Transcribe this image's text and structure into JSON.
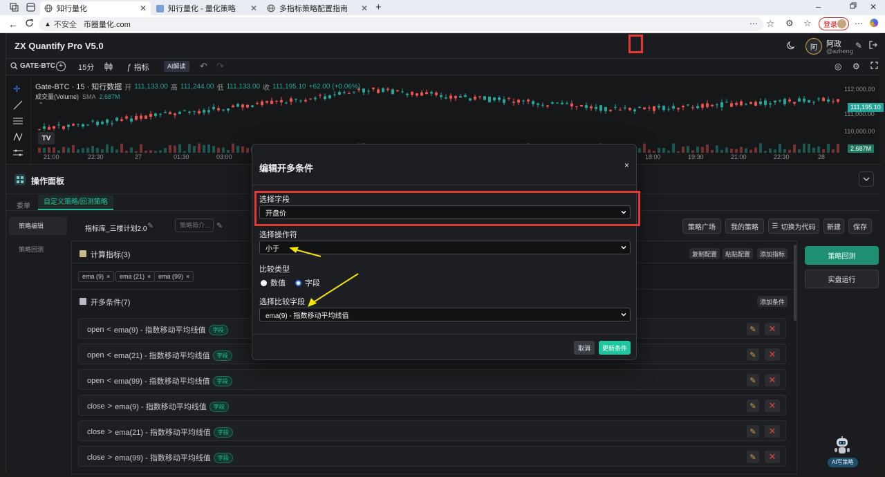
{
  "browser": {
    "tabs": [
      {
        "title": "知行量化",
        "active": true
      },
      {
        "title": "知行量化 - 量化策略",
        "active": false
      },
      {
        "title": "多指标策略配置指南",
        "active": false
      }
    ],
    "insecure_label": "不安全",
    "url": "币圈量化.com",
    "login_label": "登录"
  },
  "app": {
    "title": "ZX Quantify Pro V5.0",
    "user": {
      "avatar_text": "阿",
      "name": "阿政",
      "handle": "@azheng"
    }
  },
  "toolbar": {
    "symbol": "GATE-BTC",
    "interval": "15分",
    "indicator_label": "指标",
    "ai_label": "AI解读"
  },
  "chart": {
    "legend_title": "Gate-BTC · 15 · 知行数据",
    "ohlc": {
      "o_label": "开",
      "o": "111,133.00",
      "h_label": "高",
      "h": "111,244.00",
      "l_label": "低",
      "l": "111,133.00",
      "c_label": "收",
      "c": "111,195.10",
      "chg": "+62.00 (+0.06%)"
    },
    "volume_label": "成交量(Volume)",
    "volume_sma": "SMA",
    "volume_value": "2.687M",
    "y_ticks": [
      "112,000.00",
      "111,000.00",
      "110,000.00"
    ],
    "price_tag": "111,195.10",
    "volume_tag": "2.687M",
    "x_ticks": [
      "21:00",
      "22:30",
      "27",
      "01:30",
      "03:00",
      "18:00",
      "19:30",
      "21:00",
      "22:30",
      "28"
    ],
    "colors": {
      "up": "#26a69a",
      "down": "#ef5350"
    }
  },
  "panel": {
    "title": "操作面板",
    "tabs": [
      "委单",
      "自定义策略/回测策略"
    ],
    "side_nav": [
      "策略编辑",
      "策略回测"
    ],
    "strategy_name": "指标库_三楼计划2.0",
    "strategy_desc_placeholder": "策略简介...",
    "top_buttons": [
      "策略广场",
      "我的策略",
      "切换为代码",
      "新建",
      "保存"
    ],
    "indicators_section": {
      "title": "计算指标(3)",
      "buttons": [
        "复制配置",
        "粘贴配置",
        "添加指标"
      ],
      "chips": [
        "ema (9)",
        "ema (21)",
        "ema (99)"
      ]
    },
    "conditions_section": {
      "title": "开多条件(7)",
      "add_button": "添加条件",
      "rows": [
        {
          "left": "open",
          "op": "<",
          "right": "ema(9) - 指数移动平均线值",
          "badge": "字段"
        },
        {
          "left": "open",
          "op": "<",
          "right": "ema(21) - 指数移动平均线值",
          "badge": "字段"
        },
        {
          "left": "open",
          "op": "<",
          "right": "ema(99) - 指数移动平均线值",
          "badge": "字段"
        },
        {
          "left": "close",
          "op": ">",
          "right": "ema(9) - 指数移动平均线值",
          "badge": "字段"
        },
        {
          "left": "close",
          "op": ">",
          "right": "ema(21) - 指数移动平均线值",
          "badge": "字段"
        },
        {
          "left": "close",
          "op": ">",
          "right": "ema(99) - 指数移动平均线值",
          "badge": "字段"
        }
      ]
    },
    "right_buttons": [
      "策略回测",
      "实盘运行"
    ],
    "ai_bot_label": "AI写策略"
  },
  "modal": {
    "title": "编辑开多条件",
    "close": "×",
    "field_label": "选择字段",
    "field_value": "开盘价",
    "operator_label": "选择操作符",
    "operator_value": "小于",
    "compare_type_label": "比较类型",
    "compare_options": [
      "数值",
      "字段"
    ],
    "compare_selected": "字段",
    "compare_field_label": "选择比较字段",
    "compare_field_value": "ema(9) - 指数移动平均线值",
    "cancel_label": "取消",
    "confirm_label": "更新条件",
    "accent": "#1fc7a0",
    "highlight": "#e53935",
    "arrow_color": "#f5e400"
  }
}
